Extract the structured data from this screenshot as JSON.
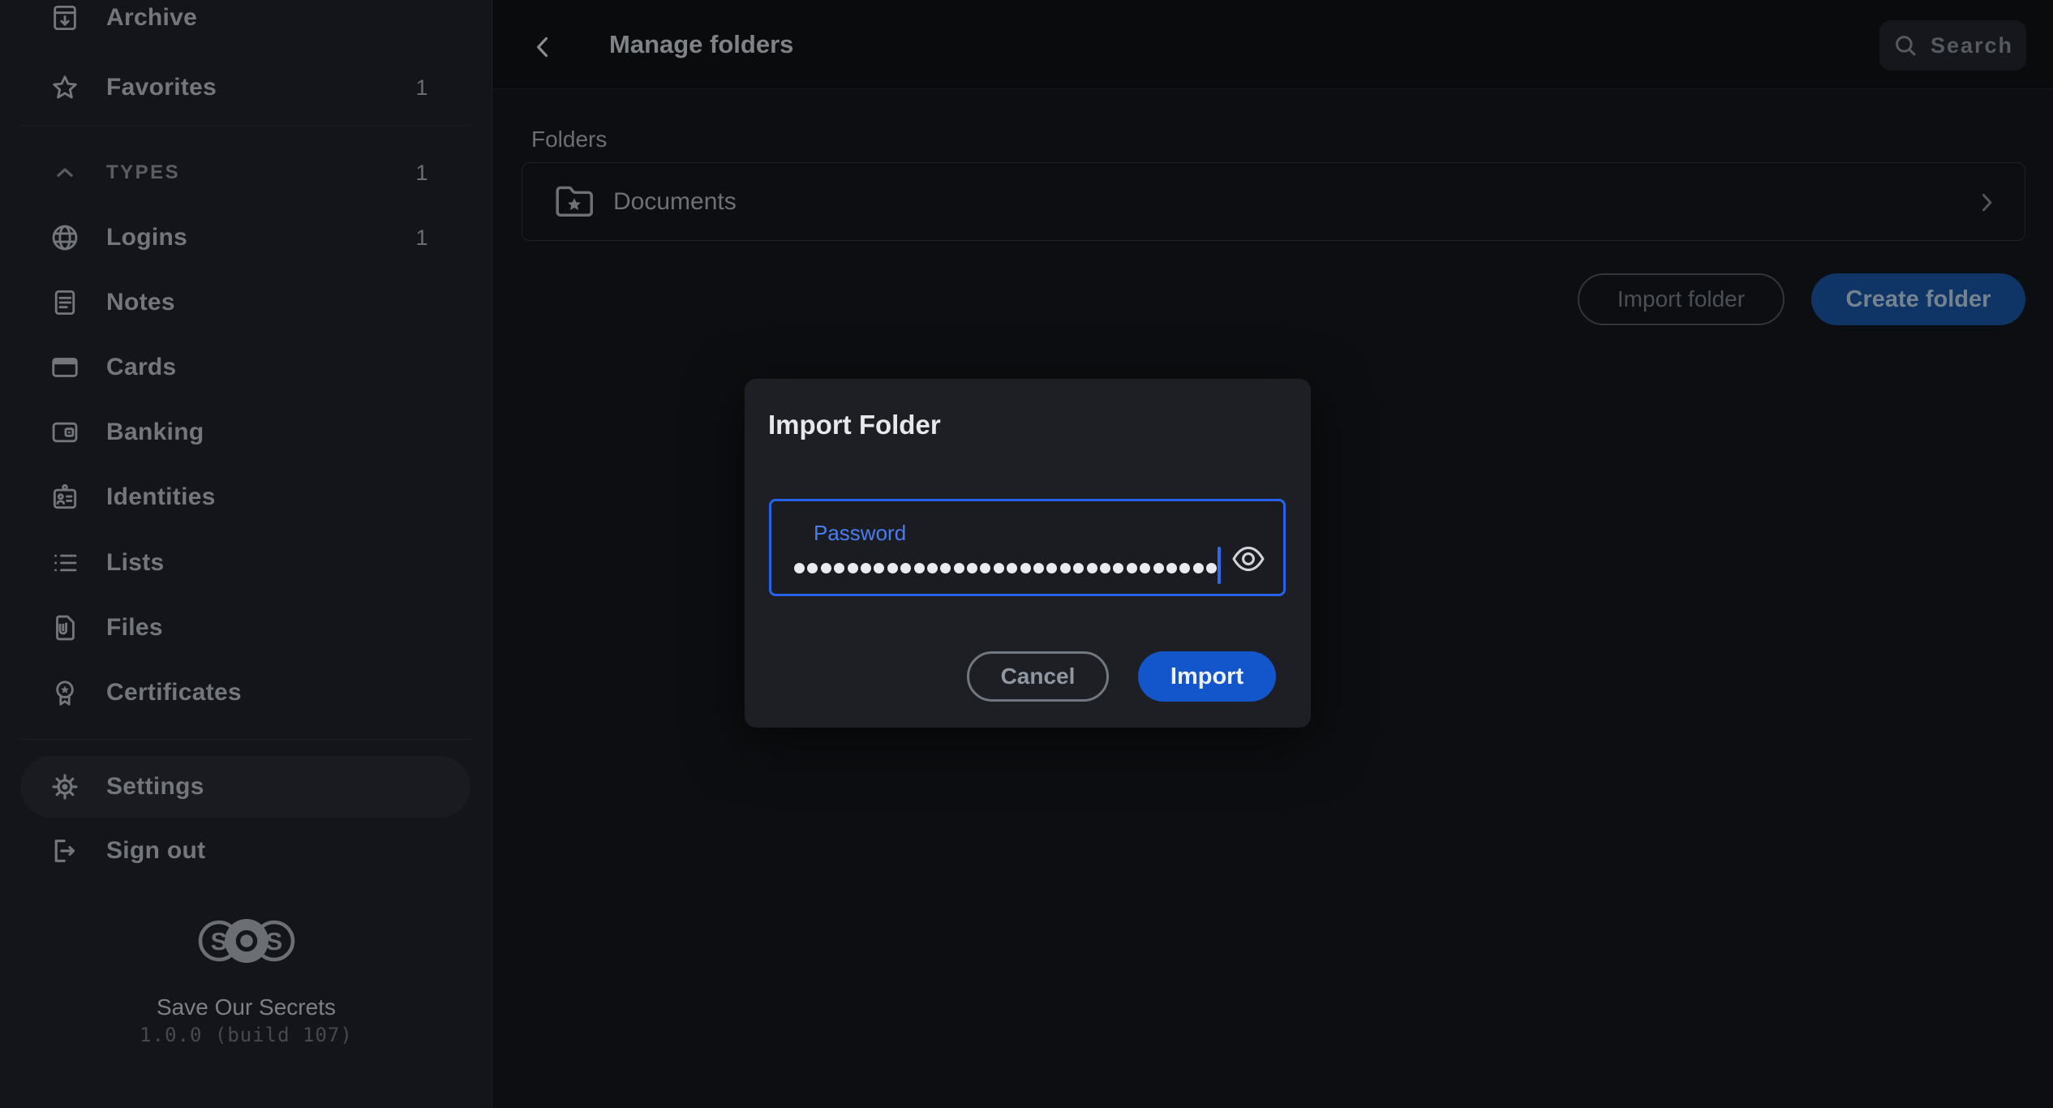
{
  "sidebar": {
    "items": [
      {
        "label": "Archive",
        "badge": ""
      },
      {
        "label": "Favorites",
        "badge": "1"
      }
    ],
    "types": {
      "label": "TYPES",
      "badge": "1"
    },
    "type_items": [
      {
        "label": "Logins",
        "badge": "1"
      },
      {
        "label": "Notes",
        "badge": ""
      },
      {
        "label": "Cards",
        "badge": ""
      },
      {
        "label": "Banking",
        "badge": ""
      },
      {
        "label": "Identities",
        "badge": ""
      },
      {
        "label": "Lists",
        "badge": ""
      },
      {
        "label": "Files",
        "badge": ""
      },
      {
        "label": "Certificates",
        "badge": ""
      }
    ],
    "settings_label": "Settings",
    "sign_out_label": "Sign out",
    "app_name": "Save Our Secrets",
    "version": "1.0.0 (build 107)",
    "logo_letters": {
      "left": "S",
      "middle": "O",
      "right": "S"
    }
  },
  "header": {
    "title": "Manage folders",
    "search_label": "Search"
  },
  "content": {
    "section_label": "Folders",
    "folders": [
      {
        "name": "Documents"
      }
    ],
    "import_button": "Import folder",
    "create_button": "Create folder"
  },
  "modal": {
    "title": "Import Folder",
    "password_label": "Password",
    "password_dots": 32,
    "cancel_button": "Cancel",
    "import_button": "Import"
  },
  "colors": {
    "accent_blue": "#2563eb",
    "import_button_bg": "#1356cb",
    "create_button_bg": "#0e3565",
    "modal_bg": "#1d1f24",
    "sidebar_bg": "#14151a",
    "page_bg": "#0c0d0f"
  }
}
